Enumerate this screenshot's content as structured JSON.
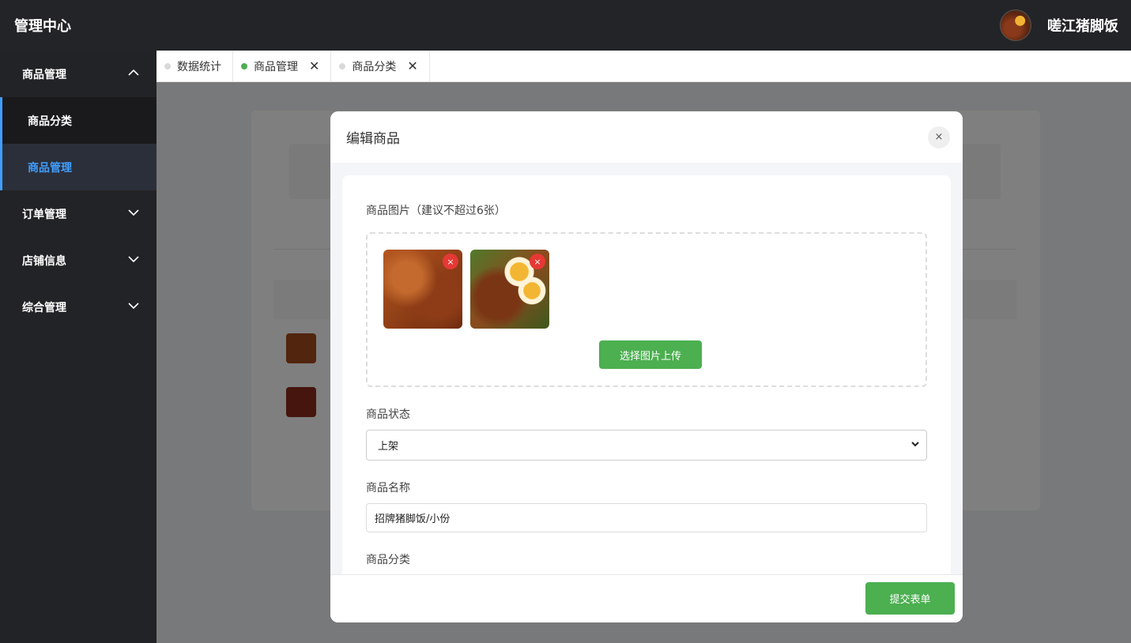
{
  "header": {
    "app_title": "管理中心",
    "shop_name": "嗟江猪脚饭"
  },
  "sidebar": {
    "groups": [
      {
        "label": "商品管理",
        "expanded": true,
        "items": [
          {
            "label": "商品分类"
          },
          {
            "label": "商品管理",
            "active": true
          }
        ]
      },
      {
        "label": "订单管理",
        "expanded": false
      },
      {
        "label": "店铺信息",
        "expanded": false
      },
      {
        "label": "综合管理",
        "expanded": false
      }
    ]
  },
  "tabs": [
    {
      "label": "数据统计",
      "closable": false,
      "active": false
    },
    {
      "label": "商品管理",
      "closable": true,
      "active": true
    },
    {
      "label": "商品分类",
      "closable": true,
      "active": false
    }
  ],
  "modal": {
    "title": "编辑商品",
    "close_label": "×",
    "images_label": "商品图片（建议不超过6张）",
    "remove_label": "×",
    "upload_label": "选择图片上传",
    "status_label": "商品状态",
    "status_value": "上架",
    "name_label": "商品名称",
    "name_value": "招牌猪脚饭/小份",
    "category_label": "商品分类",
    "submit_label": "提交表单"
  },
  "colors": {
    "accent": "#4caf50",
    "sidebar_active": "#409eff",
    "topbar": "#232427",
    "danger": "#e53935"
  }
}
